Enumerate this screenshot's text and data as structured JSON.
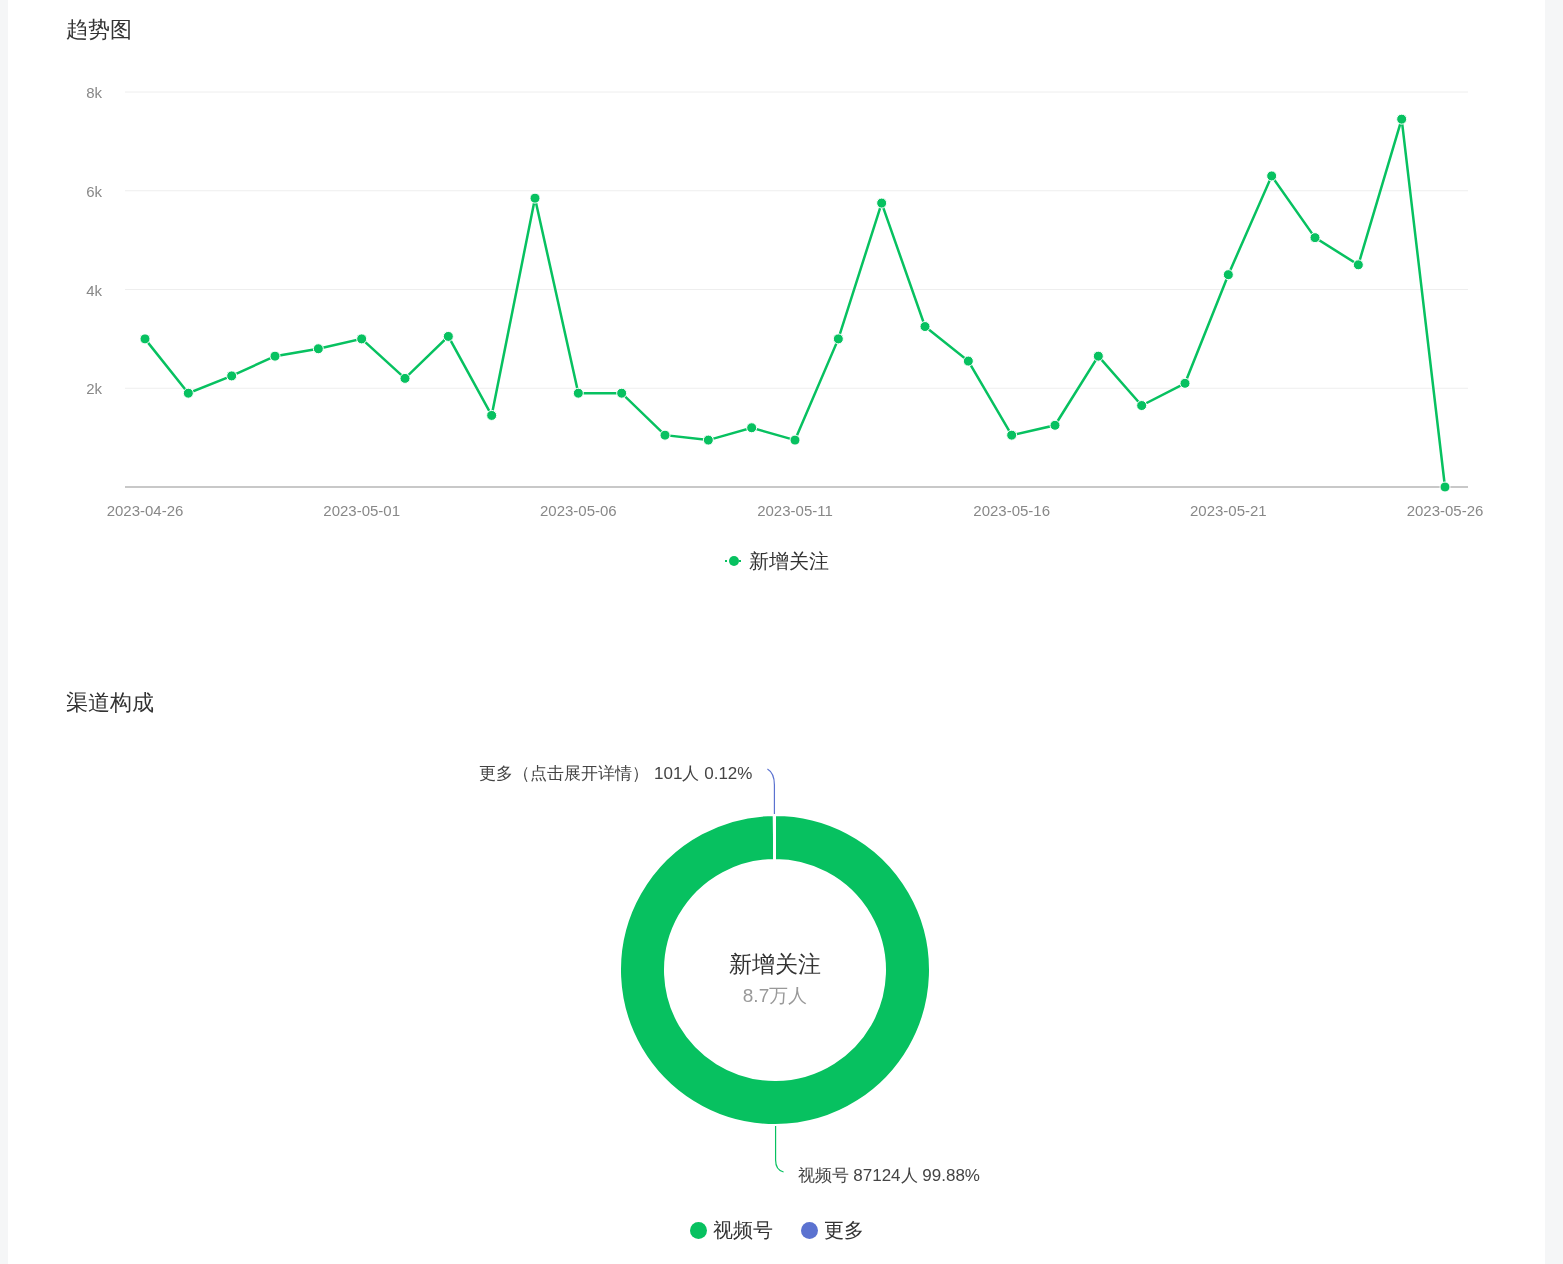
{
  "trend": {
    "title": "趋势图",
    "chart_data": {
      "type": "line",
      "categories": [
        "2023-04-26",
        null,
        null,
        null,
        null,
        "2023-05-01",
        null,
        null,
        null,
        null,
        "2023-05-06",
        null,
        null,
        null,
        null,
        "2023-05-11",
        null,
        null,
        null,
        null,
        "2023-05-16",
        null,
        null,
        null,
        null,
        "2023-05-21",
        null,
        null,
        null,
        null,
        "2023-05-26"
      ],
      "series": [
        {
          "name": "新增关注",
          "color": "#07c160",
          "marker": true,
          "values": [
            3000,
            1900,
            2250,
            2650,
            2800,
            3000,
            2200,
            3050,
            1450,
            5850,
            1900,
            1900,
            1050,
            950,
            1200,
            950,
            3000,
            5750,
            3250,
            2550,
            1050,
            1250,
            2650,
            1650,
            2100,
            4300,
            6300,
            5050,
            4500,
            7450,
            0
          ]
        }
      ],
      "ylim": [
        0,
        8000
      ],
      "yticks": [
        {
          "value": 2000,
          "label": "2k"
        },
        {
          "value": 4000,
          "label": "4k"
        },
        {
          "value": 6000,
          "label": "6k"
        },
        {
          "value": 8000,
          "label": "8k"
        }
      ],
      "legend": true,
      "grid": true
    }
  },
  "channels": {
    "title": "渠道构成",
    "center_title": "新增关注",
    "center_value": "8.7万人",
    "chart_data": {
      "type": "donut",
      "categories": [
        "视频号",
        "更多"
      ],
      "values": [
        99.88,
        0.12
      ],
      "legend": true
    },
    "slices": [
      {
        "label": "视频号 87124人 99.88%",
        "color": "#07c160"
      },
      {
        "label": "更多（点击展开详情） 101人 0.12%",
        "color": "#5b72d0"
      }
    ]
  }
}
